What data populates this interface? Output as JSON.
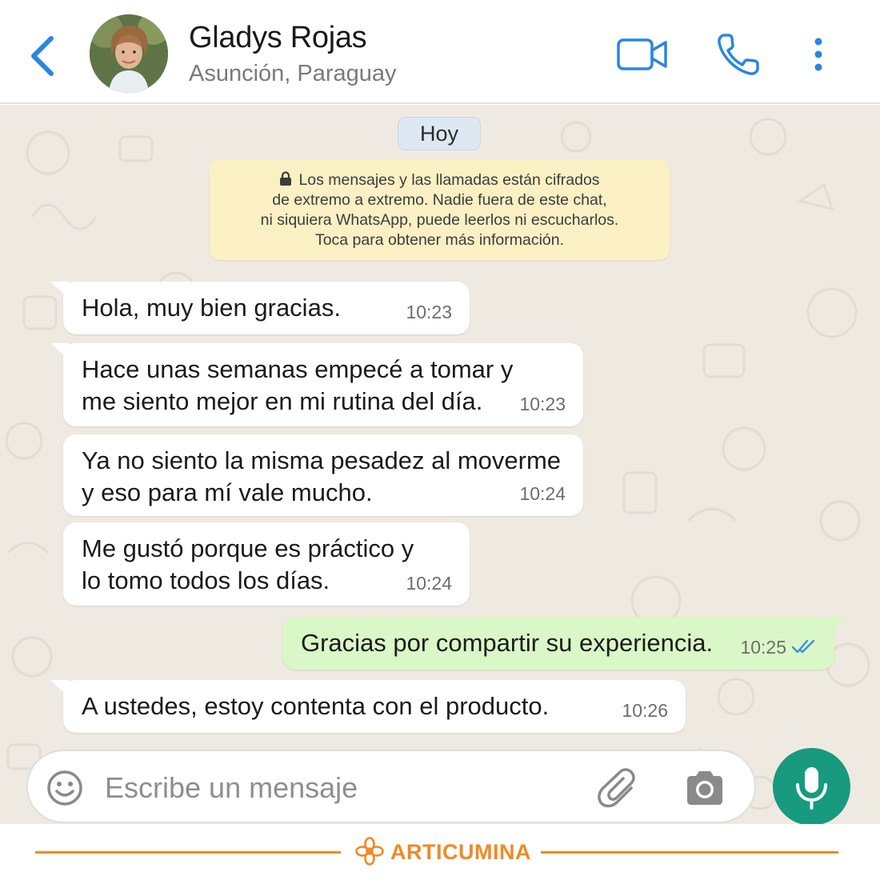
{
  "header": {
    "contact_name": "Gladys Rojas",
    "contact_location": "Asunción, Paraguay",
    "accent_color": "#2a86e0"
  },
  "chat": {
    "date_label": "Hoy",
    "encryption_notice": "Los mensajes y las llamadas están cifrados\nde extremo a extremo. Nadie fuera de este chat,\nni siquiera WhatsApp, puede leerlos ni escucharlos.\nToca para obtener más información.",
    "messages": [
      {
        "direction": "in",
        "text": "Hola, muy bien gracias.",
        "time": "10:23"
      },
      {
        "direction": "in",
        "text": "Hace unas semanas empecé a tomar y\nme siento mejor en mi rutina del día.",
        "time": "10:23"
      },
      {
        "direction": "in",
        "text": "Ya no siento la misma pesadez al moverme\ny eso para mí vale mucho.",
        "time": "10:24"
      },
      {
        "direction": "in",
        "text": "Me gustó porque es práctico y\nlo tomo todos los días.",
        "time": "10:24"
      },
      {
        "direction": "out",
        "text": "Gracias por compartir su experiencia.",
        "time": "10:25",
        "status": "read"
      },
      {
        "direction": "in",
        "text": "A ustedes, estoy contenta con el producto.",
        "time": "10:26"
      }
    ]
  },
  "composer": {
    "placeholder": "Escribe un mensaje",
    "send_color": "#179a7d"
  },
  "footer": {
    "brand": "ARTICUMINA",
    "brand_color": "#f08a24"
  },
  "icons": [
    "back-arrow-icon",
    "video-camera-icon",
    "phone-icon",
    "more-vertical-icon",
    "lock-icon",
    "double-check-icon",
    "emoji-icon",
    "paperclip-icon",
    "camera-icon",
    "microphone-icon",
    "flower-logo-icon"
  ]
}
